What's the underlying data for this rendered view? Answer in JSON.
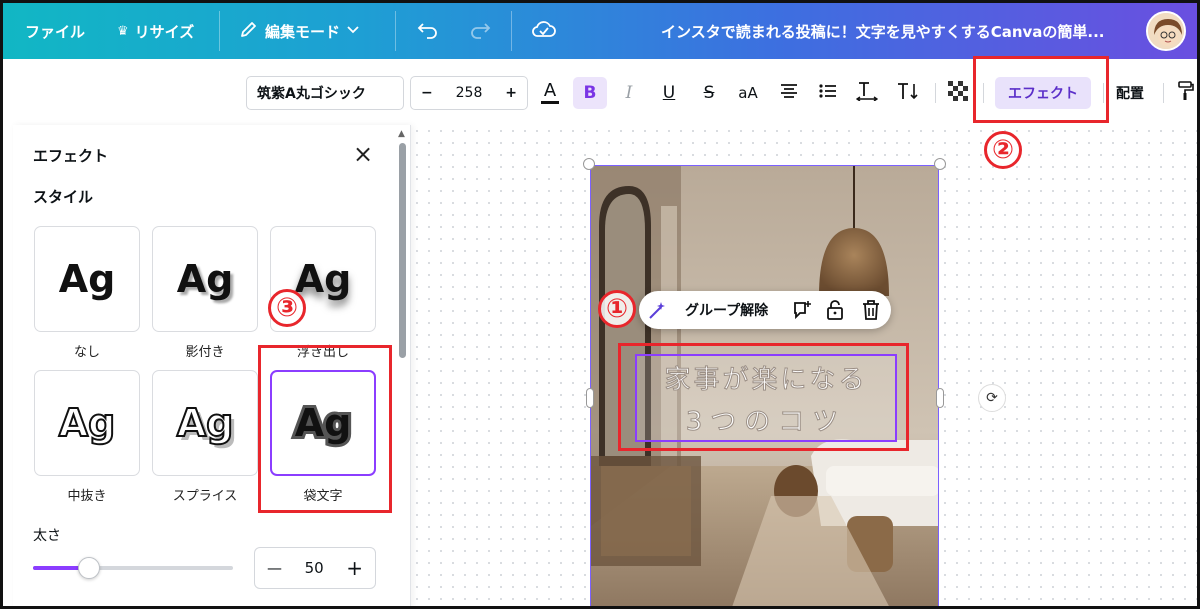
{
  "topbar": {
    "file": "ファイル",
    "resize": "リサイズ",
    "edit_mode": "編集モード",
    "doc_title": "インスタで読まれる投稿に！文字を見やすくするCanvaの簡単..."
  },
  "toolbar": {
    "font": "筑紫A丸ゴシック",
    "font_size": "258",
    "minus": "−",
    "plus": "+",
    "text_color": "A",
    "bold": "B",
    "italic": "I",
    "underline": "U",
    "strike": "S",
    "case": "aA",
    "effect": "エフェクト",
    "arrange": "配置"
  },
  "panel": {
    "title": "エフェクト",
    "style_heading": "スタイル",
    "tiles": [
      {
        "glyph": "Ag",
        "label": "なし"
      },
      {
        "glyph": "Ag",
        "label": "影付き"
      },
      {
        "glyph": "Ag",
        "label": "浮き出し"
      },
      {
        "glyph": "Ag",
        "label": "中抜き"
      },
      {
        "glyph": "Ag",
        "label": "スプライス"
      },
      {
        "glyph": "Ag",
        "label": "袋文字"
      }
    ],
    "thickness_label": "太さ",
    "thickness_value": "50",
    "thickness_fraction": 0.28,
    "minus": "—",
    "plus": "+"
  },
  "canvas": {
    "context_menu": {
      "ungroup": "グループ解除"
    },
    "text_line1": "家事が楽になる",
    "text_line2": "3つのコツ"
  },
  "annotations": {
    "n1": "①",
    "n2": "②",
    "n3": "③"
  },
  "colors": {
    "accent": "#8b3dff",
    "annotation_red": "#e8262c",
    "effect_bg": "#e9e2fb"
  }
}
